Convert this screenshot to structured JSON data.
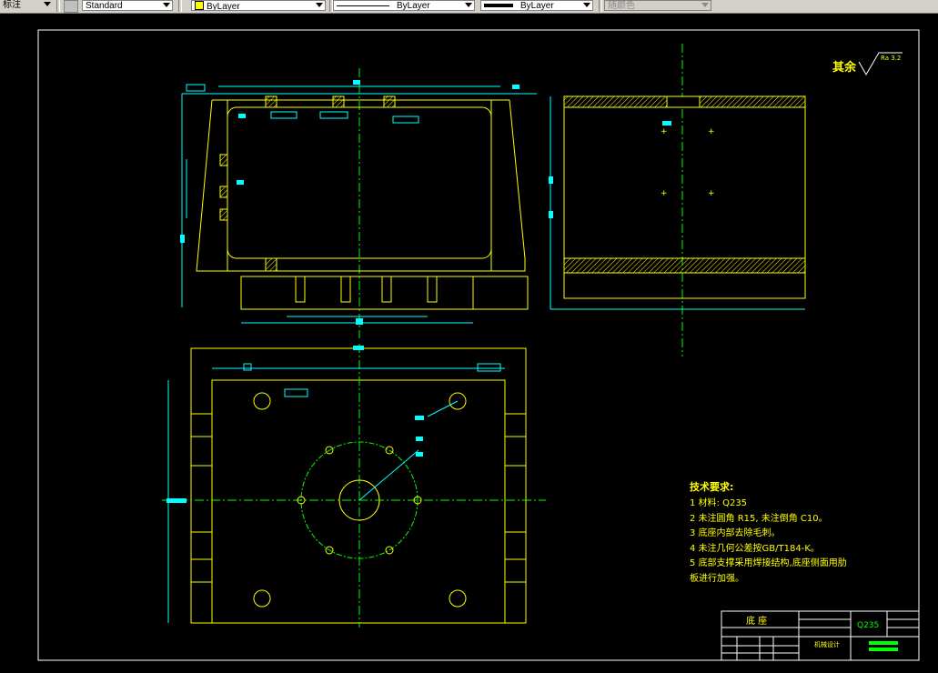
{
  "toolbar": {
    "dim_style_label": "标注",
    "text_style": "Standard",
    "layer": "ByLayer",
    "layer_color": "#ffff00",
    "linetype": "ByLayer",
    "lineweight": "ByLayer",
    "plot_style": "随颜色"
  },
  "drawing": {
    "roughness_prefix": "其余",
    "roughness_value": "Ra 3.2",
    "tech_title": "技术要求:",
    "tech_notes": [
      "1 材料: Q235",
      "2 未注圆角 R15, 未注倒角 C10。",
      "3 底座内部去除毛刺。",
      "4 未注几何公差按GB/T184-K。",
      "5 底部支撑采用焊接结构,底座侧面用肋",
      "板进行加强。"
    ],
    "title_block": {
      "part_name": "底 座",
      "material": "Q235",
      "company": "机械设计"
    }
  },
  "colors": {
    "background": "#000000",
    "outline": "#ffffff",
    "geometry": "#ffff00",
    "dimension": "#00ffff",
    "centerline": "#00ff00",
    "text": "#ffff00",
    "hatch": "#ffff00"
  }
}
